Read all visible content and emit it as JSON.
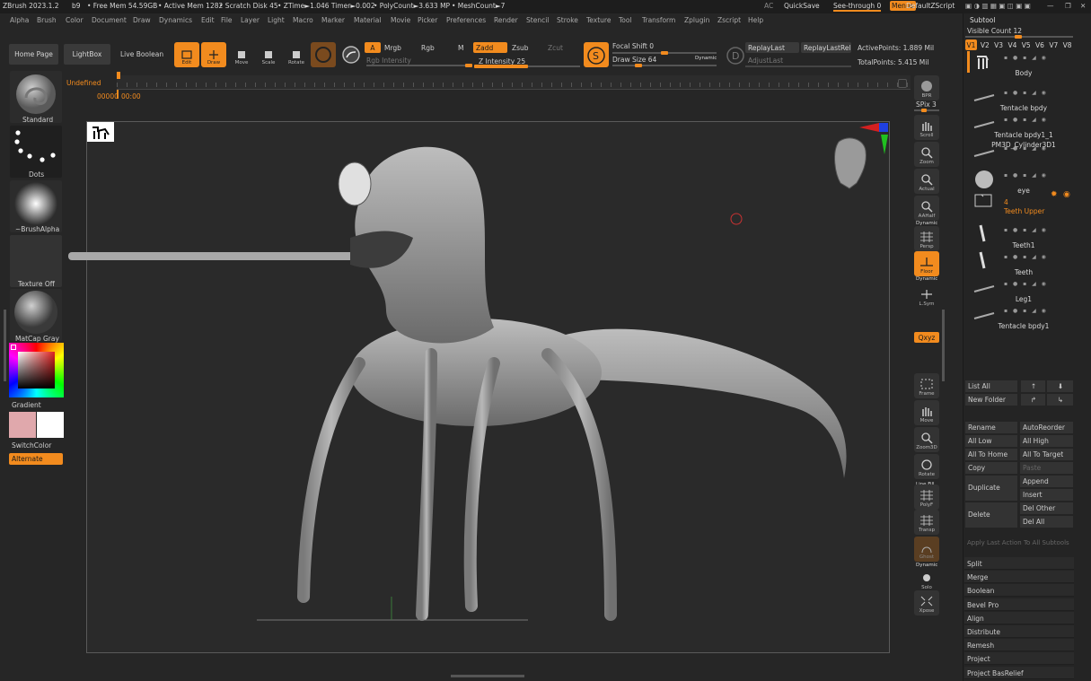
{
  "colors": {
    "accent": "#f28b1e",
    "bg": "#262626",
    "panel": "#2b2b2b",
    "button": "#3a3a3a"
  },
  "titlebar": {
    "app": "ZBrush 2023.1.2",
    "build": "b9",
    "free_mem": "• Free Mem 54.59GB",
    "active_mem": "• Active Mem 1282",
    "scratch": "• Scratch Disk 45",
    "ztime": "• ZTime►1.046 Timer►0.002",
    "polycount": "• PolyCount►3.633 MP",
    "meshcount": "• MeshCount►7",
    "ac": "AC",
    "quicksave": "QuickSave",
    "see_through": "See-through  0",
    "menus": "Menus",
    "default_zscript": "DefaultZScript"
  },
  "menubar": [
    "Alpha",
    "Brush",
    "Color",
    "Document",
    "Draw",
    "Dynamics",
    "Edit",
    "File",
    "Layer",
    "Light",
    "Macro",
    "Marker",
    "Material",
    "Movie",
    "Picker",
    "Preferences",
    "Render",
    "Stencil",
    "Stroke",
    "Texture",
    "Tool",
    "Transform",
    "Zplugin",
    "Zscript",
    "Help"
  ],
  "toolbar": {
    "home_page": "Home Page",
    "lightbox": "LightBox",
    "live_boolean": "Live Boolean",
    "edit": "Edit",
    "draw": "Draw",
    "move": "Move",
    "scale": "Scale",
    "rotate": "Rotate",
    "a": "A",
    "mrgb": "Mrgb",
    "rgb": "Rgb",
    "m": "M",
    "zadd": "Zadd",
    "zsub": "Zsub",
    "zcut": "Zcut",
    "rgb_intensity": "Rgb Intensity",
    "z_intensity": "Z Intensity 25",
    "focal_shift": "Focal Shift 0",
    "draw_size": "Draw Size 64",
    "dynamic": "Dynamic",
    "replay_last": "ReplayLast",
    "replay_last_rel": "ReplayLastRel",
    "adjust_last": "AdjustLast",
    "active_points": "ActivePoints: 1.889 Mil",
    "total_points": "TotalPoints: 5.415 Mil"
  },
  "timeline": {
    "label": "Undefined",
    "counter": "00000",
    "time": "00:00"
  },
  "left_panel": {
    "standard": "Standard",
    "dots": "Dots",
    "brush_alpha": "~BrushAlpha",
    "texture_off": "Texture Off",
    "matcap": "MatCap Gray",
    "gradient": "Gradient",
    "switch_color": "SwitchColor",
    "alternate": "Alternate"
  },
  "right_shelf": [
    "BPR",
    "SPix 3",
    "Scroll",
    "Zoom",
    "Actual",
    "AAHalf",
    "Dynamic",
    "Persp",
    "Floor",
    "Dynamic",
    "L.Sym",
    "Qxyz",
    "Frame",
    "Move",
    "Zoom3D",
    "Rotate",
    "Line Fill",
    "PolyF",
    "Transp",
    "Ghost",
    "Dynamic",
    "Solo",
    "Xpose"
  ],
  "subtool": {
    "title": "Subtool",
    "visible_count": "Visible Count 12",
    "versions": [
      "V1",
      "V2",
      "V3",
      "V4",
      "V5",
      "V6",
      "V7",
      "V8"
    ],
    "items": [
      "Body",
      "Tentacle bpdy",
      "Tentacle bpdy1_1",
      "PM3D_Cylinder3D1",
      "eye",
      "Teeth Upper",
      "Teeth1",
      "Teeth",
      "Leg1",
      "Tentacle bpdy1"
    ],
    "folder_count": "4",
    "list_all": "List All",
    "new_folder": "New Folder",
    "rename": "Rename",
    "auto_reorder": "AutoReorder",
    "all_low": "All Low",
    "all_high": "All High",
    "all_to_home": "All To Home",
    "all_to_target": "All To Target",
    "copy": "Copy",
    "paste": "Paste",
    "duplicate": "Duplicate",
    "append": "Append",
    "insert": "Insert",
    "delete": "Delete",
    "del_other": "Del Other",
    "del_all": "Del All",
    "apply_last": "Apply Last Action To All Subtools",
    "sections": [
      "Split",
      "Merge",
      "Boolean",
      "Bevel Pro",
      "Align",
      "Distribute",
      "Remesh",
      "Project",
      "Project BasRelief"
    ]
  }
}
